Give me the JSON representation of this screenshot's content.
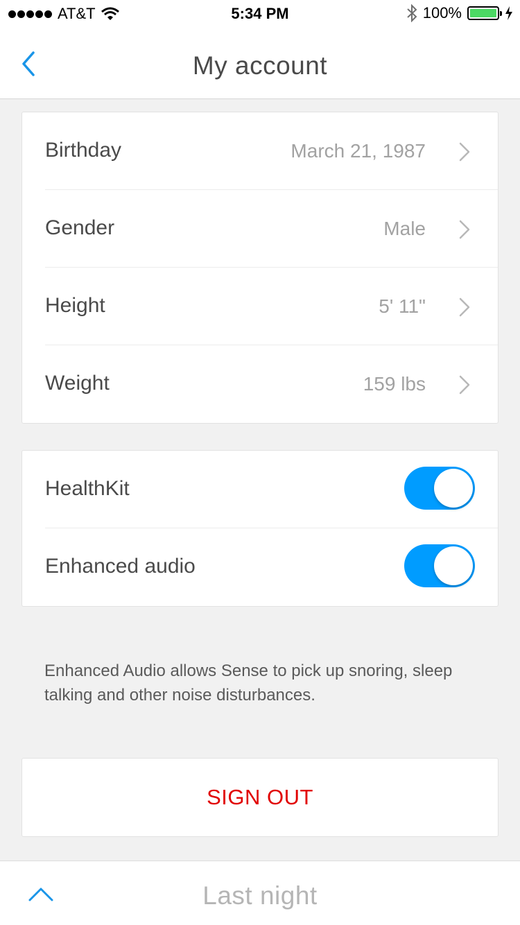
{
  "status_bar": {
    "carrier": "AT&T",
    "time": "5:34 PM",
    "battery": "100%",
    "signal_bars": 5,
    "battery_level": 1.0
  },
  "nav": {
    "title": "My account",
    "back_icon": "chevron-left-icon"
  },
  "profile": {
    "items": [
      {
        "label": "Birthday",
        "value": "March 21, 1987"
      },
      {
        "label": "Gender",
        "value": "Male"
      },
      {
        "label": "Height",
        "value": "5' 11\""
      },
      {
        "label": "Weight",
        "value": "159 lbs"
      }
    ]
  },
  "settings": {
    "items": [
      {
        "label": "HealthKit",
        "enabled": true
      },
      {
        "label": "Enhanced audio",
        "enabled": true
      }
    ]
  },
  "footnote": "Enhanced Audio allows Sense to pick up snoring, sleep talking and other noise disturbances.",
  "sign_out_label": "SIGN OUT",
  "bottom_bar": {
    "title": "Last night",
    "expand_icon": "chevron-up-icon"
  },
  "colors": {
    "accent": "#009cff",
    "danger": "#e10000",
    "battery": "#4cd964"
  }
}
